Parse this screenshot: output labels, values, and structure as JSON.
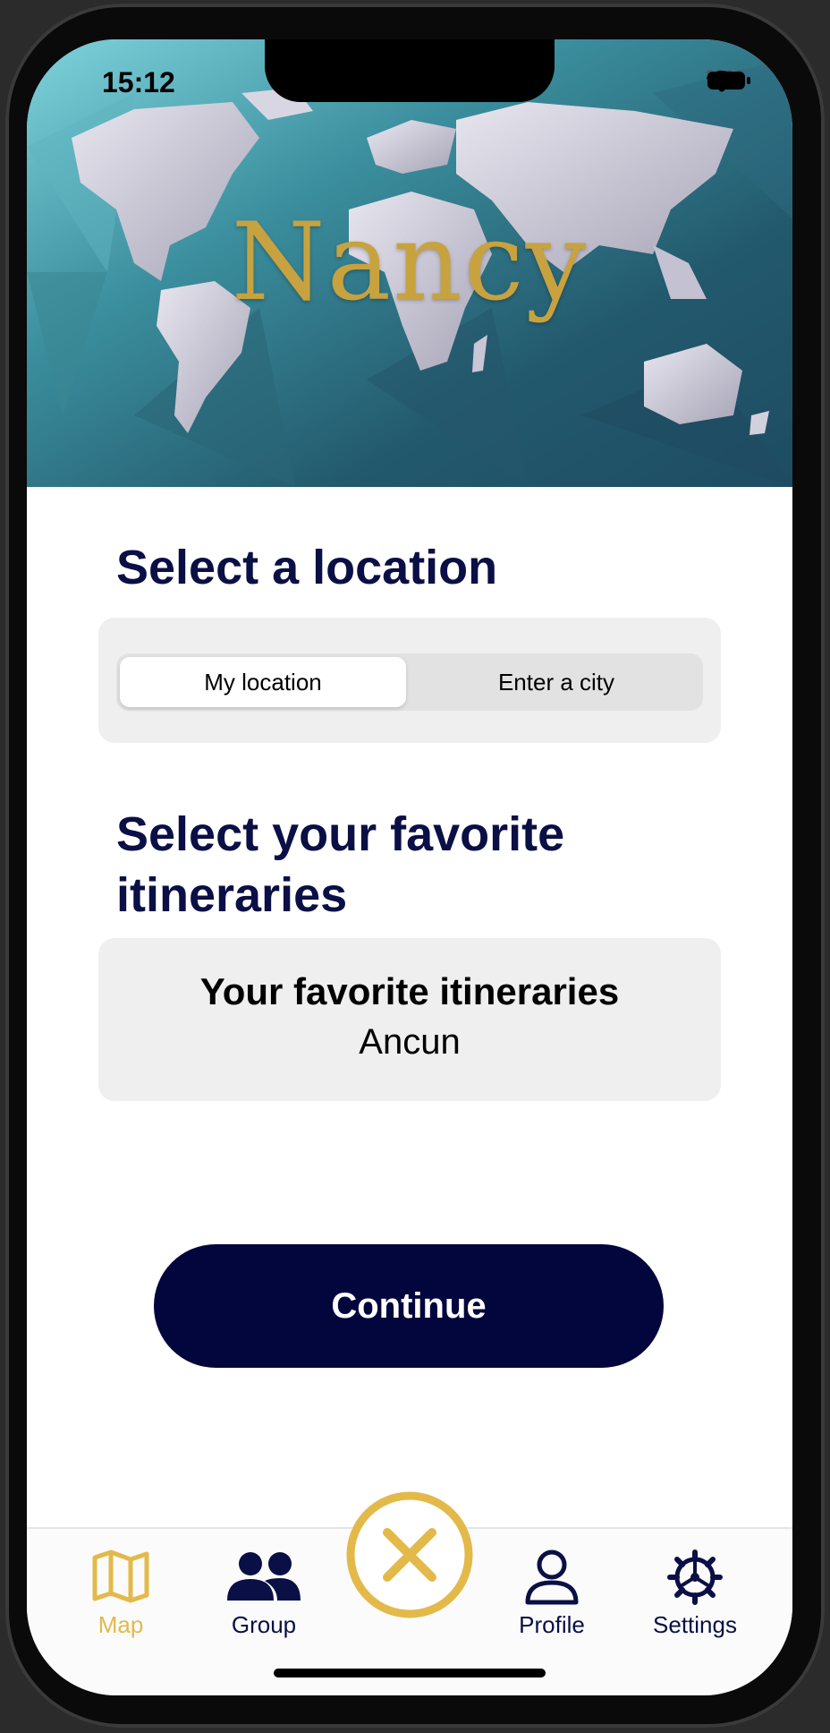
{
  "status_bar": {
    "time": "15:12"
  },
  "header": {
    "brand_title": "Nancy",
    "brand_color": "#c7a23e"
  },
  "location_section": {
    "title": "Select a location",
    "options": [
      {
        "label": "My location",
        "selected": true
      },
      {
        "label": "Enter a city",
        "selected": false
      }
    ]
  },
  "itineraries_section": {
    "title_line1": "Select your favorite",
    "title_line2": "itineraries",
    "card_title": "Your favorite itineraries",
    "card_value": "Ancun"
  },
  "continue_button": {
    "label": "Continue",
    "color": "#02063c"
  },
  "tab_bar": {
    "active_color": "#e3b94a",
    "inactive_color": "#0a0f45",
    "items": [
      {
        "label": "Map",
        "icon": "map-icon",
        "active": true
      },
      {
        "label": "Group",
        "icon": "group-icon",
        "active": false
      },
      {
        "label": "Profile",
        "icon": "profile-icon",
        "active": false
      },
      {
        "label": "Settings",
        "icon": "gear-icon",
        "active": false
      }
    ],
    "center_button_icon": "close-icon"
  }
}
